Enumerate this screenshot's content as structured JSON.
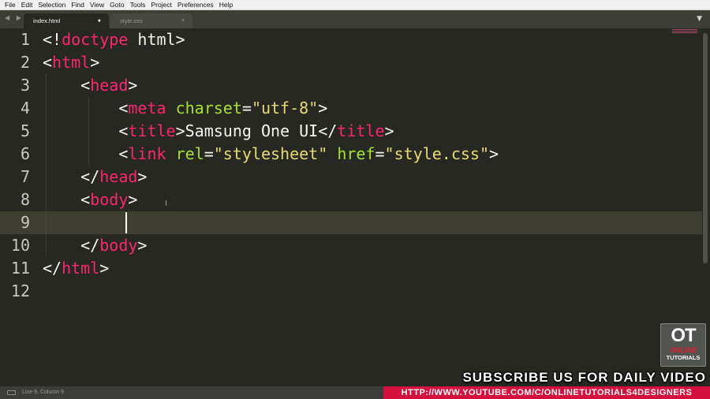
{
  "menu": [
    "File",
    "Edit",
    "Selection",
    "Find",
    "View",
    "Goto",
    "Tools",
    "Project",
    "Preferences",
    "Help"
  ],
  "tabs": [
    {
      "label": "index.html",
      "active": true,
      "control": "●"
    },
    {
      "label": "style.css",
      "active": false,
      "control": "×"
    }
  ],
  "tab_arrows": "◀ ▶",
  "tab_menu_icon": "▼",
  "editor": {
    "line_numbers": [
      "1",
      "2",
      "3",
      "4",
      "5",
      "6",
      "7",
      "8",
      "9",
      "10",
      "11",
      "12"
    ],
    "current_line": "9",
    "lines": [
      [
        {
          "c": "p",
          "t": "<!"
        },
        {
          "c": "t",
          "t": "doctype"
        },
        {
          "c": "p",
          "t": " html>"
        }
      ],
      [
        {
          "c": "p",
          "t": "<"
        },
        {
          "c": "t",
          "t": "html"
        },
        {
          "c": "p",
          "t": ">"
        }
      ],
      [
        {
          "c": "p",
          "t": "    <"
        },
        {
          "c": "t",
          "t": "head"
        },
        {
          "c": "p",
          "t": ">"
        }
      ],
      [
        {
          "c": "p",
          "t": "        <"
        },
        {
          "c": "t",
          "t": "meta"
        },
        {
          "c": "p",
          "t": " "
        },
        {
          "c": "a",
          "t": "charset"
        },
        {
          "c": "p",
          "t": "="
        },
        {
          "c": "s",
          "t": "\"utf-8\""
        },
        {
          "c": "p",
          "t": ">"
        }
      ],
      [
        {
          "c": "p",
          "t": "        <"
        },
        {
          "c": "t",
          "t": "title"
        },
        {
          "c": "p",
          "t": ">Samsung One UI</"
        },
        {
          "c": "t",
          "t": "title"
        },
        {
          "c": "p",
          "t": ">"
        }
      ],
      [
        {
          "c": "p",
          "t": "        <"
        },
        {
          "c": "t",
          "t": "link"
        },
        {
          "c": "p",
          "t": " "
        },
        {
          "c": "a",
          "t": "rel"
        },
        {
          "c": "p",
          "t": "="
        },
        {
          "c": "s",
          "t": "\"stylesheet\""
        },
        {
          "c": "p",
          "t": " "
        },
        {
          "c": "a",
          "t": "href"
        },
        {
          "c": "p",
          "t": "="
        },
        {
          "c": "s",
          "t": "\"style.css\""
        },
        {
          "c": "p",
          "t": ">"
        }
      ],
      [
        {
          "c": "p",
          "t": "    </"
        },
        {
          "c": "t",
          "t": "head"
        },
        {
          "c": "p",
          "t": ">"
        }
      ],
      [
        {
          "c": "p",
          "t": "    <"
        },
        {
          "c": "t",
          "t": "body"
        },
        {
          "c": "p",
          "t": ">"
        }
      ],
      [],
      [
        {
          "c": "p",
          "t": "    </"
        },
        {
          "c": "t",
          "t": "body"
        },
        {
          "c": "p",
          "t": ">"
        }
      ],
      [
        {
          "c": "p",
          "t": "</"
        },
        {
          "c": "t",
          "t": "html"
        },
        {
          "c": "p",
          "t": ">"
        }
      ],
      []
    ]
  },
  "status": {
    "text": "Line 9, Column 9"
  },
  "watermark": {
    "logo_big": "OT",
    "logo_online": "ONLINE",
    "logo_tutorials": "TUTORIALS",
    "subscribe": "SUBSCRIBE US FOR DAILY VIDEO",
    "url": "HTTP://WWW.YOUTUBE.COM/C/ONLINETUTORIALS4DESIGNERS"
  },
  "colors": {
    "background": "#272822",
    "tag": "#f92672",
    "attribute": "#a6e22e",
    "string": "#e6db74",
    "text": "#f8f8f2",
    "banner_red": "#d5103d"
  }
}
